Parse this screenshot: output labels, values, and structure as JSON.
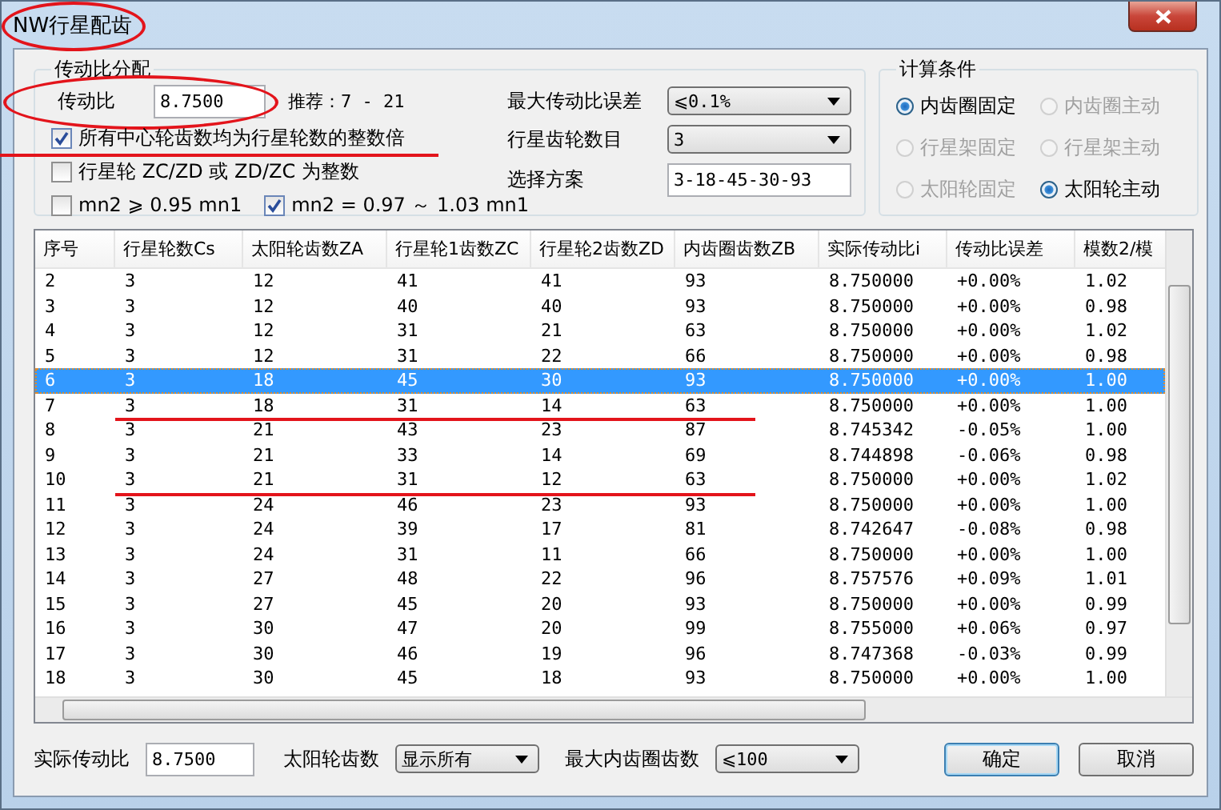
{
  "window": {
    "title": "NW行星配齿",
    "title_circled": true
  },
  "ratio_group": {
    "title": "传动比分配",
    "ratio_label": "传动比",
    "ratio_value": "8.7500",
    "ratio_circled": true,
    "recommend": "推荐：7 - 21",
    "option_rows": [
      [
        {
          "label": "所有中心轮齿数均为行星轮数的整数倍",
          "checked": true,
          "underlined": true
        }
      ],
      [
        {
          "label": "行星轮 ZC/ZD 或 ZD/ZC 为整数",
          "checked": false,
          "underlined": false
        }
      ],
      [
        {
          "label": "mn2 ⩾ 0.95 mn1",
          "checked": false,
          "underlined": false
        },
        {
          "label": "mn2 = 0.97 ～ 1.03 mn1",
          "checked": true,
          "underlined": false
        }
      ]
    ],
    "fields": [
      {
        "label": "最大传动比误差",
        "value": "⩽0.1%",
        "kind": "dropdown"
      },
      {
        "label": "行星齿轮数目",
        "value": "3",
        "kind": "dropdown"
      },
      {
        "label": "选择方案",
        "value": "3-18-45-30-93",
        "kind": "text"
      }
    ]
  },
  "conditions": {
    "title": "计算条件",
    "radios": [
      {
        "label": "内齿圈固定",
        "selected": true,
        "disabled": false
      },
      {
        "label": "内齿圈主动",
        "selected": false,
        "disabled": true
      },
      {
        "label": "行星架固定",
        "selected": false,
        "disabled": true
      },
      {
        "label": "行星架主动",
        "selected": false,
        "disabled": true
      },
      {
        "label": "太阳轮固定",
        "selected": false,
        "disabled": true
      },
      {
        "label": "太阳轮主动",
        "selected": true,
        "disabled": false
      }
    ]
  },
  "table": {
    "columns": [
      "序号",
      "行星轮数Cs",
      "太阳轮齿数ZA",
      "行星轮1齿数ZC",
      "行星轮2齿数ZD",
      "内齿圈齿数ZB",
      "实际传动比i",
      "传动比误差",
      "模数2/模"
    ],
    "rows": [
      {
        "cells": [
          "2",
          "3",
          "12",
          "41",
          "41",
          "93",
          "8.750000",
          "+0.00%",
          "1.02"
        ],
        "selected": false,
        "underlined": false
      },
      {
        "cells": [
          "3",
          "3",
          "12",
          "40",
          "40",
          "93",
          "8.750000",
          "+0.00%",
          "0.98"
        ],
        "selected": false,
        "underlined": false
      },
      {
        "cells": [
          "4",
          "3",
          "12",
          "31",
          "21",
          "63",
          "8.750000",
          "+0.00%",
          "1.02"
        ],
        "selected": false,
        "underlined": false
      },
      {
        "cells": [
          "5",
          "3",
          "12",
          "31",
          "22",
          "66",
          "8.750000",
          "+0.00%",
          "0.98"
        ],
        "selected": false,
        "underlined": false
      },
      {
        "cells": [
          "6",
          "3",
          "18",
          "45",
          "30",
          "93",
          "8.750000",
          "+0.00%",
          "1.00"
        ],
        "selected": true,
        "underlined": false
      },
      {
        "cells": [
          "7",
          "3",
          "18",
          "31",
          "14",
          "63",
          "8.750000",
          "+0.00%",
          "1.00"
        ],
        "selected": false,
        "underlined": true
      },
      {
        "cells": [
          "8",
          "3",
          "21",
          "43",
          "23",
          "87",
          "8.745342",
          "-0.05%",
          "1.00"
        ],
        "selected": false,
        "underlined": false
      },
      {
        "cells": [
          "9",
          "3",
          "21",
          "33",
          "14",
          "69",
          "8.744898",
          "-0.06%",
          "0.98"
        ],
        "selected": false,
        "underlined": false
      },
      {
        "cells": [
          "10",
          "3",
          "21",
          "31",
          "12",
          "63",
          "8.750000",
          "+0.00%",
          "1.02"
        ],
        "selected": false,
        "underlined": true
      },
      {
        "cells": [
          "11",
          "3",
          "24",
          "46",
          "23",
          "93",
          "8.750000",
          "+0.00%",
          "1.00"
        ],
        "selected": false,
        "underlined": false
      },
      {
        "cells": [
          "12",
          "3",
          "24",
          "39",
          "17",
          "81",
          "8.742647",
          "-0.08%",
          "0.98"
        ],
        "selected": false,
        "underlined": false
      },
      {
        "cells": [
          "13",
          "3",
          "24",
          "31",
          "11",
          "66",
          "8.750000",
          "+0.00%",
          "1.00"
        ],
        "selected": false,
        "underlined": false
      },
      {
        "cells": [
          "14",
          "3",
          "27",
          "48",
          "22",
          "96",
          "8.757576",
          "+0.09%",
          "1.01"
        ],
        "selected": false,
        "underlined": false
      },
      {
        "cells": [
          "15",
          "3",
          "27",
          "45",
          "20",
          "93",
          "8.750000",
          "+0.00%",
          "0.99"
        ],
        "selected": false,
        "underlined": false
      },
      {
        "cells": [
          "16",
          "3",
          "30",
          "47",
          "20",
          "99",
          "8.755000",
          "+0.06%",
          "0.97"
        ],
        "selected": false,
        "underlined": false
      },
      {
        "cells": [
          "17",
          "3",
          "30",
          "46",
          "19",
          "96",
          "8.747368",
          "-0.03%",
          "0.99"
        ],
        "selected": false,
        "underlined": false
      },
      {
        "cells": [
          "18",
          "3",
          "30",
          "45",
          "18",
          "93",
          "8.750000",
          "+0.00%",
          "1.00"
        ],
        "selected": false,
        "underlined": false
      }
    ]
  },
  "bottom": {
    "fields": [
      {
        "label": "实际传动比",
        "value": "8.7500",
        "kind": "text"
      },
      {
        "label": "太阳轮齿数",
        "value": "显示所有",
        "kind": "dropdown"
      },
      {
        "label": "最大内齿圈齿数",
        "value": "⩽100",
        "kind": "dropdown"
      }
    ],
    "buttons": [
      {
        "label": "确定",
        "default": true
      },
      {
        "label": "取消",
        "default": false
      }
    ]
  }
}
